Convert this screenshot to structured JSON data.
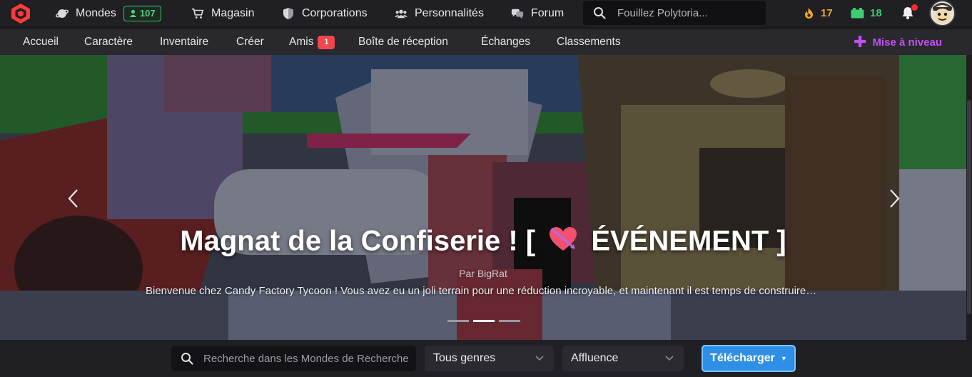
{
  "topbar": {
    "nav": [
      {
        "label": "Mondes",
        "icon": "planet-icon"
      },
      {
        "label": "Magasin",
        "icon": "cart-icon"
      },
      {
        "label": "Corporations",
        "icon": "shield-icon"
      },
      {
        "label": "Personnalités",
        "icon": "users-icon"
      },
      {
        "label": "Forum",
        "icon": "chat-icon"
      }
    ],
    "online_count": "107",
    "search_placeholder": "Fouillez Polytoria...",
    "stars": "17",
    "bricks": "18",
    "colors": {
      "accent_green": "#37c46b",
      "stars": "#f5a623",
      "bricks": "#3ccf72"
    }
  },
  "subnav": {
    "items": [
      {
        "label": "Accueil"
      },
      {
        "label": "Caractère"
      },
      {
        "label": "Inventaire"
      },
      {
        "label": "Créer"
      },
      {
        "label": "Amis",
        "badge": "1"
      },
      {
        "label": "Boîte de réception"
      },
      {
        "label": "Échanges"
      },
      {
        "label": "Classements"
      }
    ],
    "upgrade": "Mise à niveau",
    "upgrade_color": "#c24ff0"
  },
  "hero": {
    "title_before": "Magnat de la Confiserie ! [",
    "title_after": "ÉVÉNEMENT ]",
    "author": "Par BigRat",
    "description": "Bienvenue chez Candy Factory Tycoon ! Vous avez eu un joli terrain pour une réduction incroyable, et maintenant il est temps de construire votre empire de la confiserie",
    "slides_count": 3,
    "active_slide": 1
  },
  "filters": {
    "search_placeholder": "Recherche dans les Mondes de Recherche",
    "genre": "Tous genres",
    "sort": "Affluence",
    "download": "Télécharger"
  }
}
